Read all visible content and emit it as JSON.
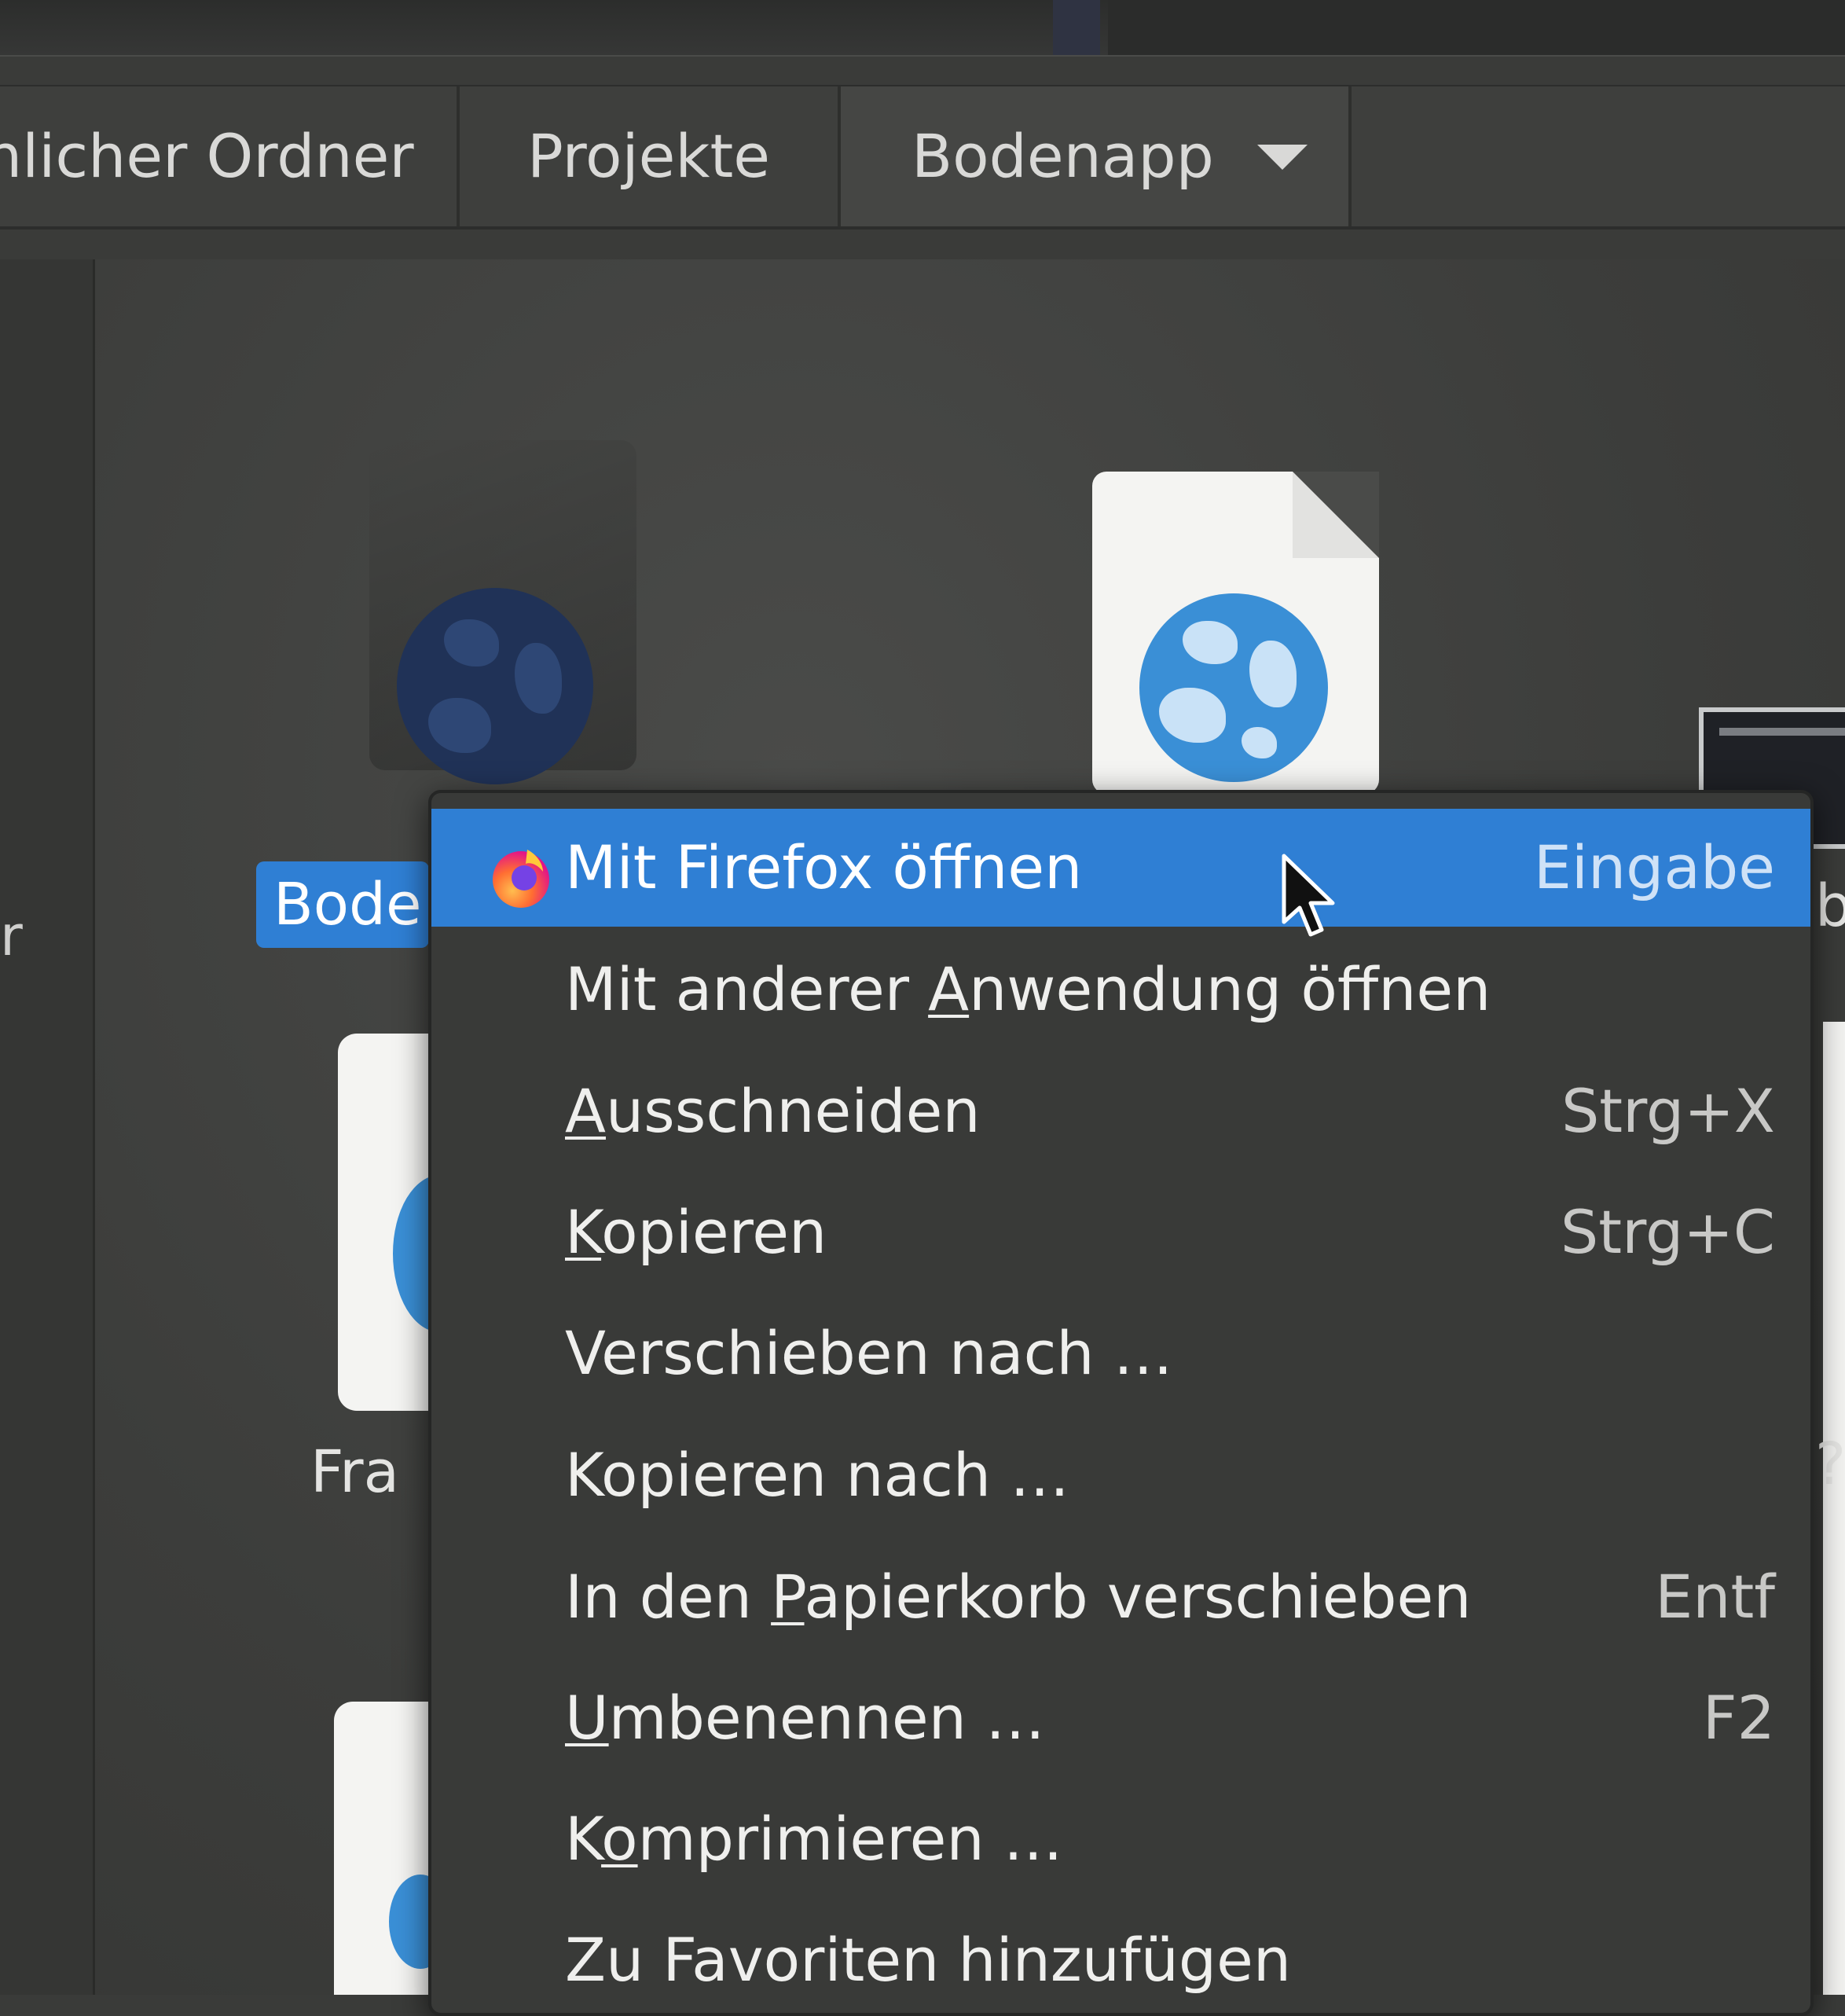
{
  "pathbar": {
    "crumbs": [
      {
        "label": "nlicher Ordner"
      },
      {
        "label": "Projekte"
      },
      {
        "label": "Bodenapp"
      }
    ]
  },
  "sidebar": {
    "fragment": "r"
  },
  "files": {
    "selected_label": "Bode",
    "frag_label": "Fra",
    "right_label_1": "b",
    "right_label_2": "?"
  },
  "context_menu": {
    "items": [
      {
        "label": "Mit Firefox öffnen",
        "accel": "Eingabe",
        "icon": "firefox-icon",
        "highlighted": true
      },
      {
        "label_pre": "Mit anderer ",
        "label_mn": "A",
        "label_post": "nwendung öffnen",
        "accel": ""
      },
      {
        "label_pre": "",
        "label_mn": "A",
        "label_post": "usschneiden",
        "accel": "Strg+X"
      },
      {
        "label_pre": "",
        "label_mn": "K",
        "label_post": "opieren",
        "accel": "Strg+C"
      },
      {
        "label": "Verschieben nach …",
        "accel": ""
      },
      {
        "label": "Kopieren nach …",
        "accel": ""
      },
      {
        "label_pre": "In den ",
        "label_mn": "P",
        "label_post": "apierkorb verschieben",
        "accel": "Entf"
      },
      {
        "label_pre": "",
        "label_mn": "U",
        "label_post": "mbenennen …",
        "accel": "F2"
      },
      {
        "label_pre": "K",
        "label_mn": "o",
        "label_post": "mprimieren …",
        "accel": ""
      },
      {
        "label": "Zu Favoriten hinzufügen",
        "accel": ""
      }
    ]
  },
  "colors": {
    "highlight": "#2f7fd4",
    "menu_bg": "#393a38",
    "globe_blue": "#3a8fd6"
  }
}
